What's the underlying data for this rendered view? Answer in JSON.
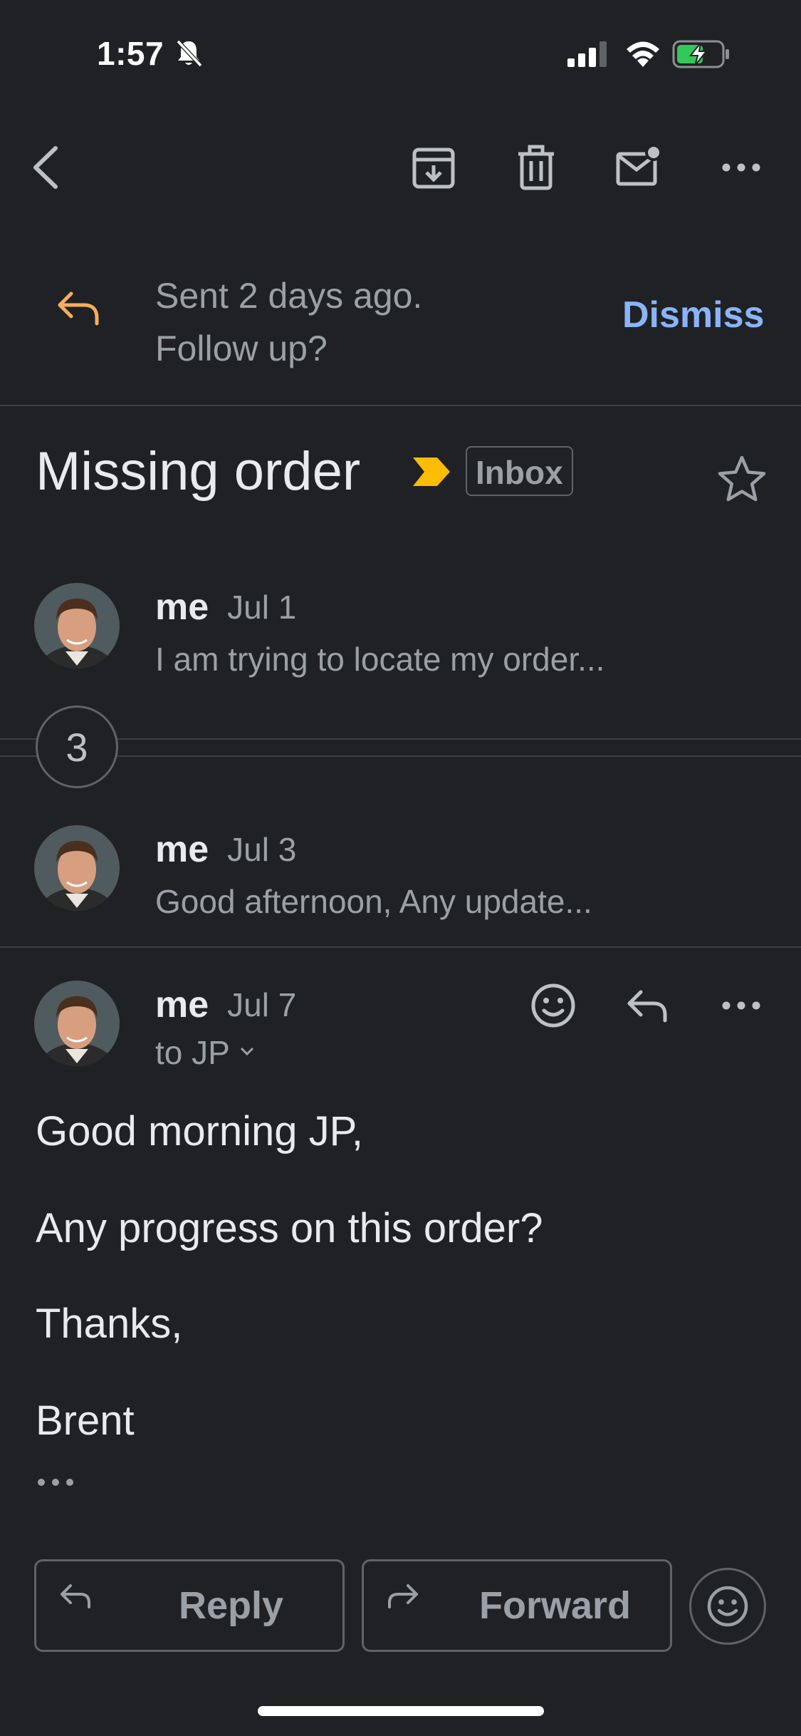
{
  "status_bar": {
    "time": "1:57"
  },
  "toolbar": {
    "icons": [
      "back-icon",
      "archive-icon",
      "trash-icon",
      "mark-unread-icon",
      "more-icon"
    ]
  },
  "followup": {
    "line1": "Sent 2 days ago.",
    "line2": "Follow up?",
    "dismiss_label": "Dismiss"
  },
  "thread": {
    "subject": "Missing order",
    "label": "Inbox",
    "collapsed_count": "3"
  },
  "messages": [
    {
      "sender": "me",
      "date": "Jul 1",
      "snippet": "I am trying to locate my order..."
    },
    {
      "sender": "me",
      "date": "Jul 3",
      "snippet": "Good afternoon, Any update..."
    },
    {
      "sender": "me",
      "date": "Jul 7",
      "to": "to JP",
      "body": [
        "Good morning JP,",
        "Any progress on this order?",
        "Thanks,",
        "Brent"
      ]
    }
  ],
  "actions": {
    "reply": "Reply",
    "forward": "Forward"
  },
  "colors": {
    "background": "#202124",
    "accent_blue": "#8ab4f8",
    "importance_yellow": "#fbbc04",
    "followup_orange": "#f6ae5c"
  }
}
